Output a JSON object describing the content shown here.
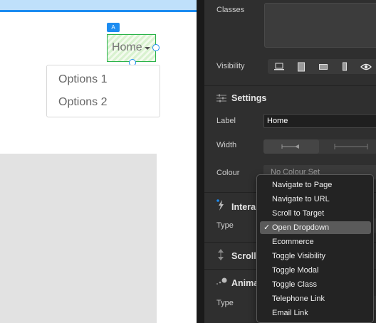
{
  "canvas": {
    "badge": "A",
    "dropdown_label": "Home",
    "menu_items": [
      "Options 1",
      "Options 2"
    ]
  },
  "panel": {
    "classes_label": "Classes",
    "visibility_label": "Visibility",
    "settings": {
      "title": "Settings",
      "label_label": "Label",
      "label_value": "Home",
      "width_label": "Width",
      "colour_label": "Colour",
      "colour_value": "No Colour Set"
    },
    "interactions": {
      "title": "Intera",
      "type_label": "Type"
    },
    "scroll": {
      "title": "Scroll"
    },
    "animation": {
      "title": "Anima",
      "type_label": "Type"
    }
  },
  "popup": {
    "items": [
      "Navigate to Page",
      "Navigate to URL",
      "Scroll to Target",
      "Open Dropdown",
      "Ecommerce",
      "Toggle Visibility",
      "Toggle Modal",
      "Toggle Class",
      "Telephone Link",
      "Email Link"
    ],
    "selected": "Open Dropdown",
    "check": "✓"
  },
  "colors": {
    "accent": "#1c8cf1",
    "selection_green": "#2ab34a"
  }
}
